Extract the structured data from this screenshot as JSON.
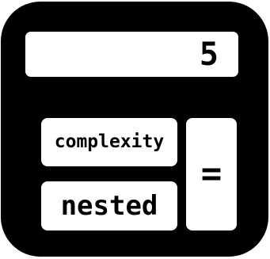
{
  "calculator": {
    "display_value": "5",
    "keys": {
      "complexity_label": "complexity",
      "nested_label": "nested",
      "equals_label": "="
    }
  },
  "colors": {
    "body": "#000000",
    "panel": "#ffffff",
    "text": "#000000"
  }
}
